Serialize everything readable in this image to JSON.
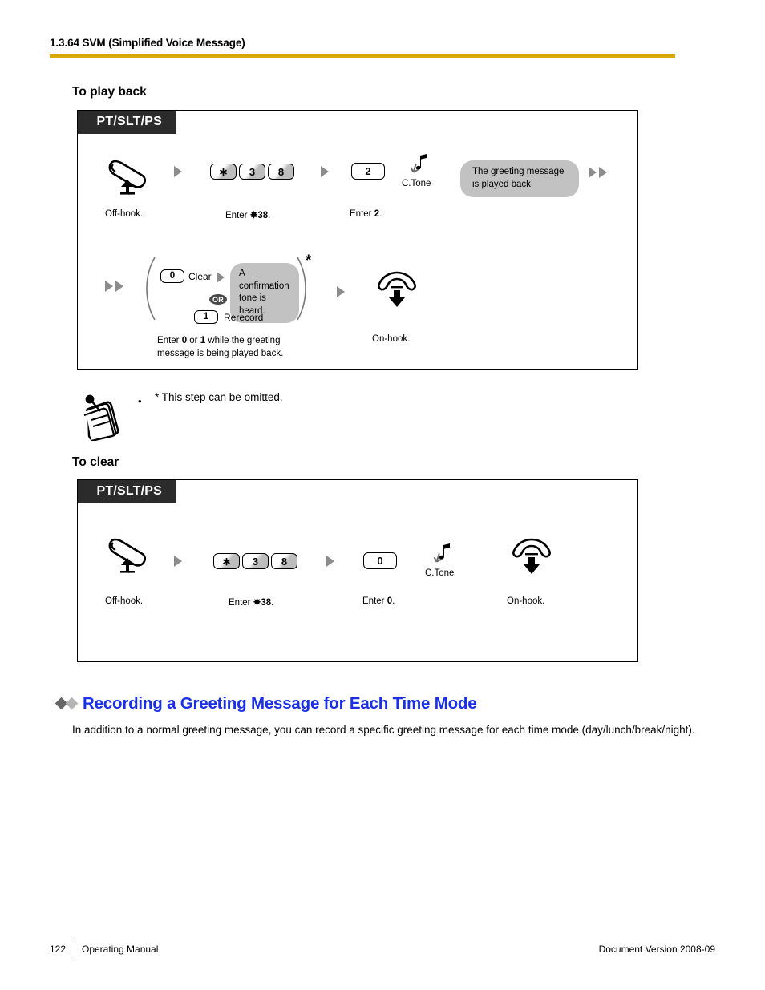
{
  "header": {
    "section_number_title": "1.3.64 SVM (Simplified Voice Message)",
    "rule_color": "#d9a908"
  },
  "sections": [
    {
      "title": "To play back",
      "device_tab": "PT/SLT/PS",
      "row1": {
        "offhook_caption": "Off-hook.",
        "offhook_icon": "handset-offhook-icon",
        "keys": [
          "∗",
          "3",
          "8"
        ],
        "keys_caption_prefix": "Enter ",
        "keys_caption_code": "✸38",
        "keys_caption_suffix": ".",
        "second_key": "2",
        "second_caption_prefix": "Enter ",
        "second_caption_code": "2",
        "second_caption_suffix": ".",
        "tone_label": "C.Tone",
        "tone_icon": "music-note-icon",
        "bubble_line1": "The greeting message",
        "bubble_line2": "is played back."
      },
      "row2": {
        "option_a_key": "0",
        "option_a_label": "Clear",
        "option_b_key": "1",
        "option_b_label": "Rerecord",
        "or_badge": "OR",
        "bubble_line1": "A confirmation",
        "bubble_line2": "tone is heard.",
        "asterisk": "*",
        "caption_line1_a": "Enter ",
        "caption_line1_b": "0",
        "caption_line1_c": " or ",
        "caption_line1_d": "1",
        "caption_line1_e": " while the greeting",
        "caption_line2": "message is being played back.",
        "onhook_caption": "On-hook.",
        "onhook_icon": "handset-onhook-icon"
      }
    },
    {
      "title": "To clear",
      "device_tab": "PT/SLT/PS",
      "row1": {
        "offhook_caption": "Off-hook.",
        "offhook_icon": "handset-offhook-icon",
        "keys": [
          "∗",
          "3",
          "8"
        ],
        "keys_caption_prefix": "Enter ",
        "keys_caption_code": "✸38",
        "keys_caption_suffix": ".",
        "second_key": "0",
        "second_caption_prefix": "Enter ",
        "second_caption_code": "0",
        "second_caption_suffix": ".",
        "tone_label": "C.Tone",
        "tone_icon": "music-note-icon",
        "onhook_caption": "On-hook.",
        "onhook_icon": "handset-onhook-icon"
      }
    }
  ],
  "note": {
    "icon": "notepad-icon",
    "bullet": "•",
    "text": "* This step can be omitted."
  },
  "feature_heading": {
    "text": "Recording a Greeting Message for Each Time Mode",
    "color": "#1a30e8",
    "diamond_dark": "#666666",
    "diamond_light": "#b5b5b5"
  },
  "body_paragraph": "In addition to a normal greeting message, you can record a specific greeting message for each time mode (day/lunch/break/night).",
  "footer": {
    "page_number": "122",
    "manual_label": "Operating Manual",
    "document_version": "Document Version  2008-09"
  }
}
